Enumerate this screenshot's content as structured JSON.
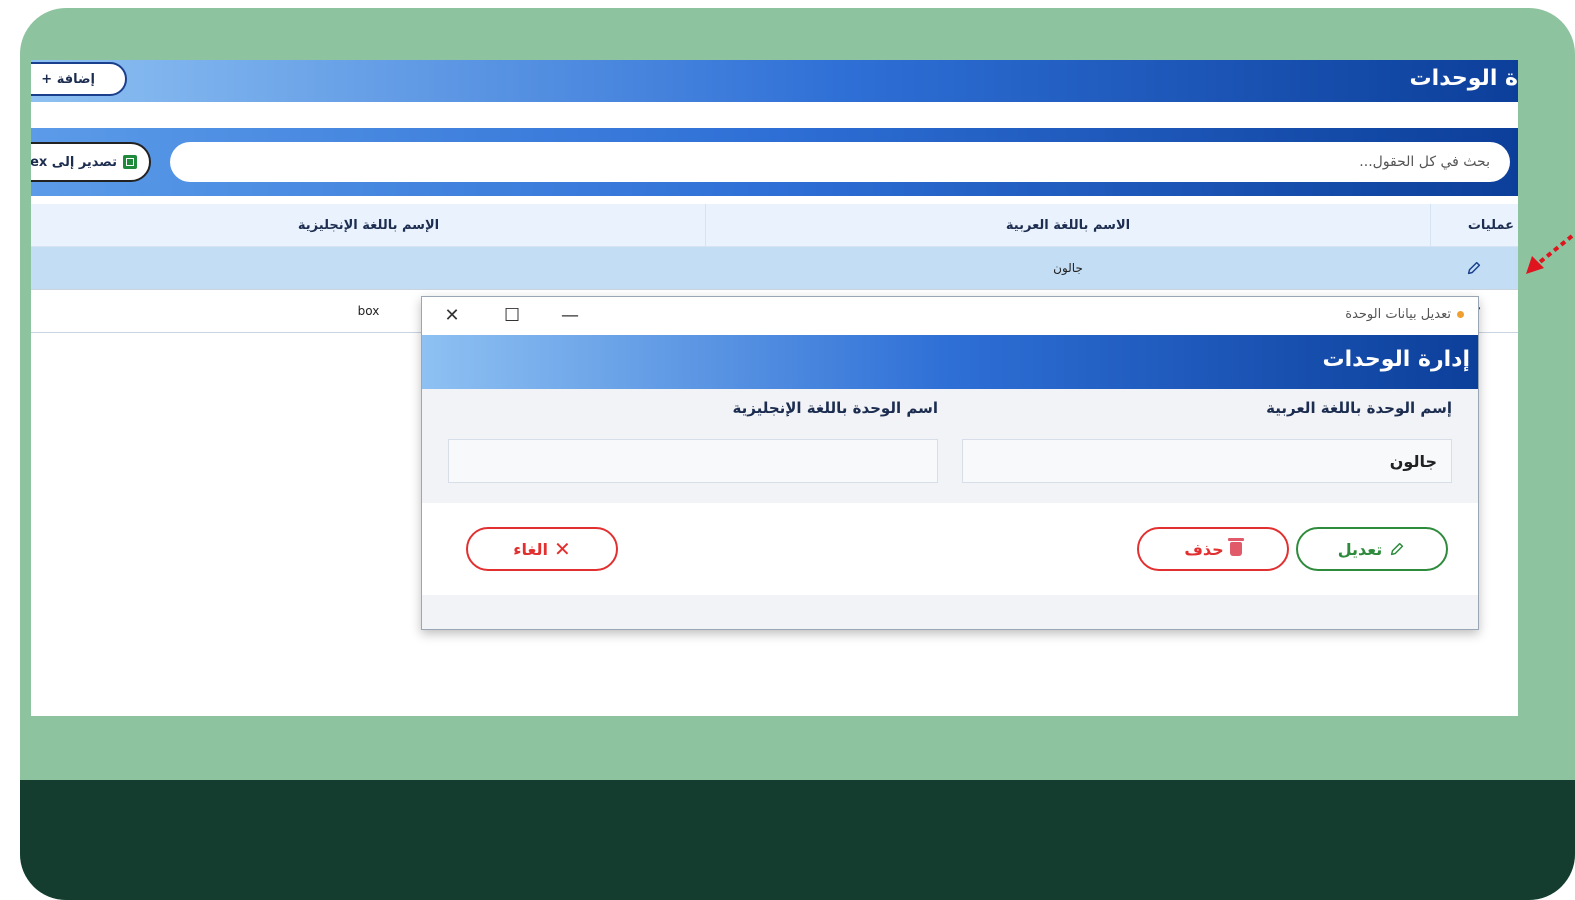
{
  "page": {
    "title": "ة الوحدات",
    "add_button": "إضافة +",
    "search_placeholder": "بحث في كل الحقول...",
    "export_button": "تصدير إلى ex"
  },
  "table": {
    "headers": {
      "ops": "عمليات",
      "arabic": "الاسم باللغة العربية",
      "english": "الإسم باللغة الإنجليزية"
    },
    "rows": [
      {
        "arabic": "جالون",
        "english": ""
      },
      {
        "arabic": "",
        "english": "box"
      }
    ]
  },
  "dialog": {
    "window_title": "تعديل بيانات الوحدة",
    "heading": "إدارة الوحدات",
    "label_arabic": "إسم الوحدة باللغة العربية",
    "label_english": "اسم الوحدة باللغة الإنجليزية",
    "value_arabic": "جالون",
    "value_english": "",
    "edit_button": "تعديل",
    "delete_button": "حذف",
    "cancel_button": "الغاء"
  },
  "colors": {
    "frame": "#8dc39f",
    "footer": "#143d2f",
    "header_dark": "#0c3f9a",
    "edit_green": "#2e8b3c",
    "danger_red": "#e23030",
    "selected_row": "#c3ddf5",
    "arrow_red": "#e0141e"
  },
  "icons": [
    "pencil-icon",
    "excel-icon",
    "trash-icon",
    "close-x-icon",
    "window-close-icon",
    "window-maximize-icon",
    "window-minimize-icon",
    "pointer-arrow-icon"
  ]
}
